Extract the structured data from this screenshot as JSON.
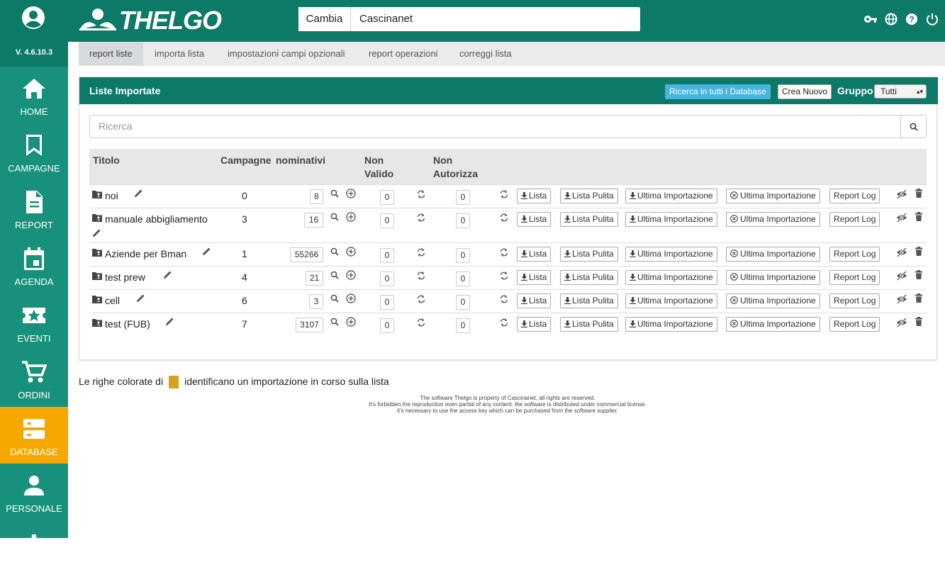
{
  "app": {
    "version": "V. 4.6.10.3",
    "logo_text": "THELGO",
    "brand_color": "#0d7a68",
    "accent_color": "#f7a800"
  },
  "sidebar": {
    "items": [
      {
        "label": "HOME",
        "icon": "home-icon",
        "active": false
      },
      {
        "label": "CAMPAGNE",
        "icon": "bookmark-icon",
        "active": false
      },
      {
        "label": "REPORT",
        "icon": "document-icon",
        "active": false
      },
      {
        "label": "AGENDA",
        "icon": "calendar-icon",
        "active": false
      },
      {
        "label": "EVENTI",
        "icon": "star-ticket-icon",
        "active": false
      },
      {
        "label": "ORDINI",
        "icon": "cart-icon",
        "active": false
      },
      {
        "label": "DATABASE",
        "icon": "database-icon",
        "active": true
      },
      {
        "label": "PERSONALE",
        "icon": "person-icon",
        "active": false
      }
    ]
  },
  "header": {
    "switch_button": "Cambia",
    "current_db": "Cascinanet",
    "icons": [
      "key-icon",
      "globe-icon",
      "help-icon",
      "power-icon"
    ]
  },
  "tabs": [
    {
      "label": "report liste",
      "active": true
    },
    {
      "label": "importa lista",
      "active": false
    },
    {
      "label": "impostazioni campi opzionali",
      "active": false
    },
    {
      "label": "report operazioni",
      "active": false
    },
    {
      "label": "correggi lista",
      "active": false
    }
  ],
  "panel": {
    "title": "Liste Importate",
    "search_all_button": "Ricerca in tutti i Database",
    "new_button": "Crea Nuovo",
    "group_label": "Gruppo",
    "group_value": "Tutti",
    "search_placeholder": "Ricerca"
  },
  "table": {
    "headers": {
      "title": "Titolo",
      "campaigns": "Campagne",
      "nominativi": "nominativi",
      "non_valido_1": "Non",
      "non_valido_2": "Valido",
      "non_autorizza_1": "Non",
      "non_autorizza_2": "Autorizza"
    },
    "action_labels": {
      "lista": "Lista",
      "lista_pulita": "Lista Pulita",
      "ultima_download": "Ultima Importazione",
      "ultima_cancel": "Ultima Importazione",
      "report_log": "Report Log"
    },
    "rows": [
      {
        "title": "noi",
        "campaigns": "0",
        "nominativi": "8",
        "non_valido": "0",
        "non_autorizza": "0"
      },
      {
        "title": "manuale abbigliamento",
        "campaigns": "3",
        "nominativi": "16",
        "non_valido": "0",
        "non_autorizza": "0"
      },
      {
        "title": "Aziende per Bman",
        "campaigns": "1",
        "nominativi": "55266",
        "non_valido": "0",
        "non_autorizza": "0"
      },
      {
        "title": "test prew",
        "campaigns": "4",
        "nominativi": "21",
        "non_valido": "0",
        "non_autorizza": "0"
      },
      {
        "title": "cell",
        "campaigns": "6",
        "nominativi": "3",
        "non_valido": "0",
        "non_autorizza": "0"
      },
      {
        "title": "test (FUB)",
        "campaigns": "7",
        "nominativi": "3107",
        "non_valido": "0",
        "non_autorizza": "0"
      }
    ]
  },
  "legend": {
    "before": "Le righe colorate di",
    "after": "identificano un importazione in corso sulla lista",
    "swatch_color": "#d9a21c"
  },
  "footer": {
    "line1": "The software Thelgo is property of Cascinanet, all rights are reserved.",
    "line2": "It's forbidden the reproduction even partial of any content. the software is distributed under commercial license.",
    "line3": "it's necessary to use the access key which can be purchased from the software supplier."
  }
}
